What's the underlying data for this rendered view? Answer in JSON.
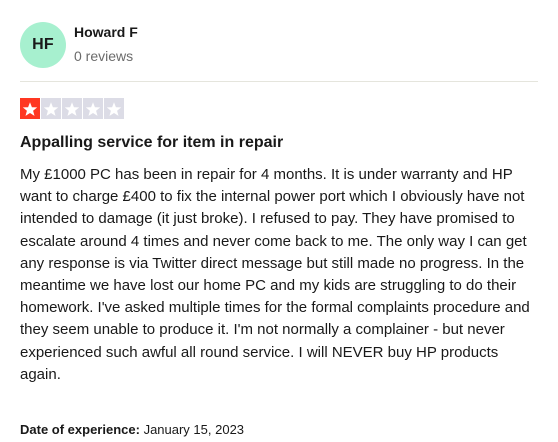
{
  "reviewer": {
    "initials": "HF",
    "name": "Howard F",
    "reviews_count": "0 reviews",
    "avatar_color": "#a7f0cf"
  },
  "rating": {
    "value": 1,
    "max": 5,
    "filled_color": "#ff3722",
    "empty_color": "#dcdce6",
    "star_icon": "star-icon"
  },
  "review": {
    "title": "Appalling service for item in repair",
    "body": "My £1000 PC has been in repair for 4 months. It is under warranty and HP want to charge £400 to fix the internal power port which I obviously have not intended to damage (it just broke). I refused to pay. They have promised to escalate around 4 times and never come back to me. The only way I can get any response is via Twitter direct message but still made no progress. In the meantime we have lost our home PC and my kids are struggling to do their homework. I've asked multiple times for the formal complaints procedure and they seem unable to produce it. I'm not normally a complainer - but never experienced such awful all round service. I will NEVER buy HP products again.",
    "experience_label": "Date of experience:",
    "experience_date": "January 15, 2023"
  }
}
